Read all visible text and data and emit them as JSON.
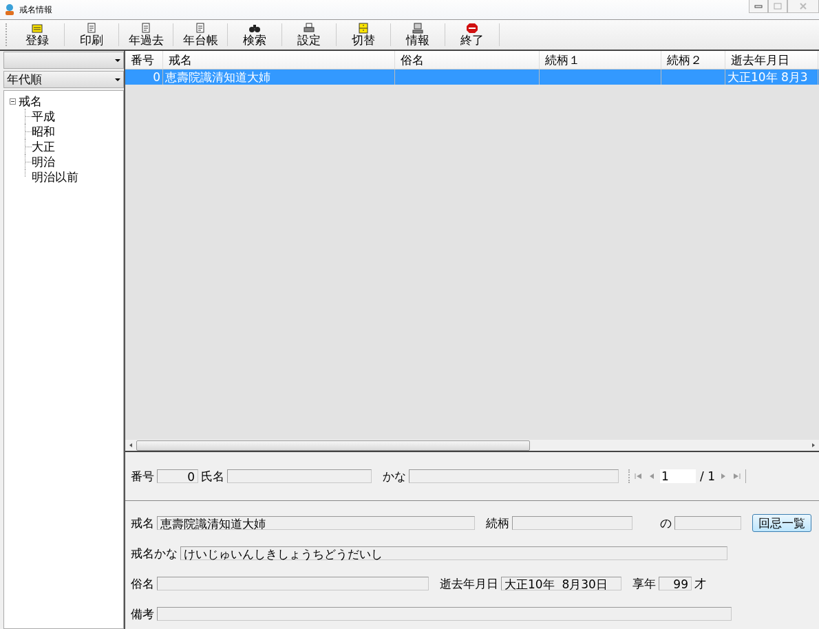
{
  "window": {
    "title": "戒名情報"
  },
  "toolbar": [
    {
      "label": "登録"
    },
    {
      "label": "印刷"
    },
    {
      "label": "年過去"
    },
    {
      "label": "年台帳"
    },
    {
      "label": "検索"
    },
    {
      "label": "設定"
    },
    {
      "label": "切替"
    },
    {
      "label": "情報"
    },
    {
      "label": "終了"
    }
  ],
  "sidebar": {
    "sort_combo": {
      "value": "年代順"
    },
    "tree": [
      {
        "label": "戒名",
        "expanded": true,
        "children": [
          {
            "label": "平成"
          },
          {
            "label": "昭和"
          },
          {
            "label": "大正"
          },
          {
            "label": "明治"
          },
          {
            "label": "明治以前"
          }
        ]
      }
    ]
  },
  "table": {
    "columns": [
      "番号",
      "戒名",
      "俗名",
      "続柄１",
      "続柄２",
      "逝去年月日"
    ],
    "rows": [
      {
        "selected": true,
        "cells": [
          "0",
          "恵壽院識清知道大姉",
          "",
          "",
          "",
          "大正10年 8月3"
        ]
      }
    ]
  },
  "form": {
    "number_label": "番号",
    "number": "0",
    "name_label": "氏名",
    "kana_label": "かな",
    "pager": {
      "current": "1",
      "total": "/ 1"
    },
    "kaimyo_label": "戒名",
    "kaimyo": "恵壽院識清知道大姉",
    "relation_label": "続柄",
    "no_label": "の",
    "memorial_button": "回忌一覧",
    "kaimyo_kana_label": "戒名かな",
    "kaimyo_kana": "けいじゅいんしきしょうちどうだいし",
    "secular_label": "俗名",
    "death_label": "逝去年月日",
    "death": "大正10年  8月30日",
    "age_label": "享年",
    "age": "99",
    "age_unit": "才",
    "notes_label": "備考"
  }
}
